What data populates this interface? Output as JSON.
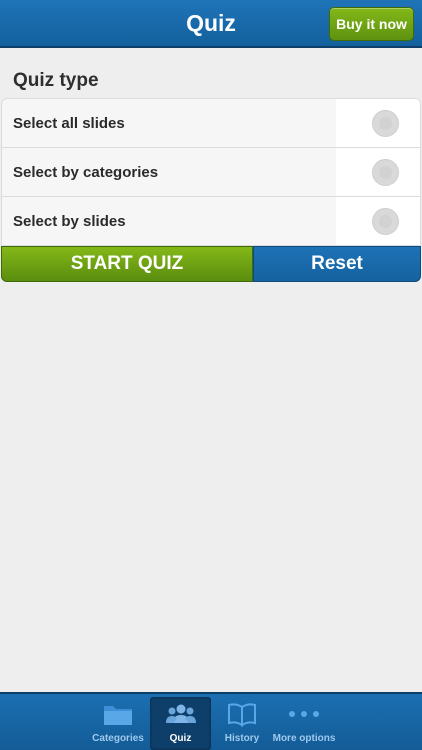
{
  "header": {
    "title": "Quiz",
    "buy_label": "Buy it now"
  },
  "section": {
    "title": "Quiz type"
  },
  "options": [
    {
      "label": "Select all slides",
      "selected": false
    },
    {
      "label": "Select by categories",
      "selected": false
    },
    {
      "label": "Select by slides",
      "selected": false
    }
  ],
  "actions": {
    "start_label": "START QUIZ",
    "reset_label": "Reset"
  },
  "tabbar": {
    "tabs": [
      {
        "label": "Categories",
        "icon": "folder-icon",
        "active": false
      },
      {
        "label": "Quiz",
        "icon": "people-icon",
        "active": true
      },
      {
        "label": "History",
        "icon": "book-icon",
        "active": false
      },
      {
        "label": "More options",
        "icon": "more-dots-icon",
        "active": false
      }
    ]
  },
  "colors": {
    "primary_blue": "#1a6db0",
    "accent_green": "#6fa514",
    "background": "#eeeeee"
  }
}
